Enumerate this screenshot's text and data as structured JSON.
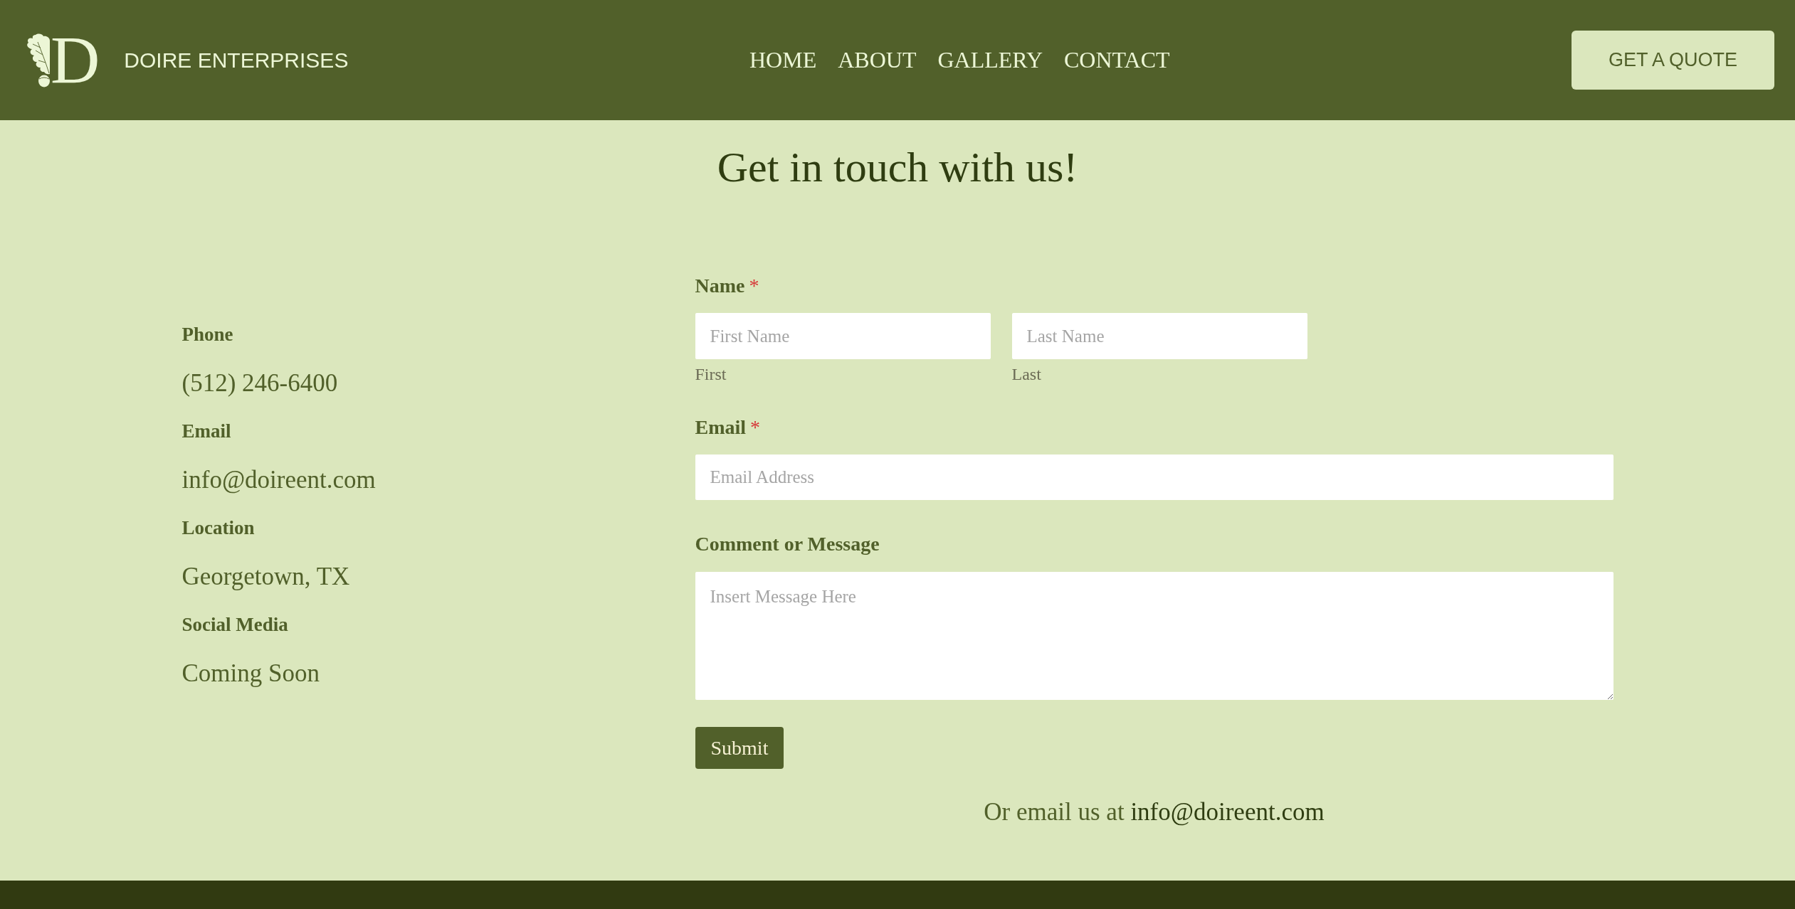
{
  "header": {
    "logo_letter": "D",
    "brand": "DOIRE ENTERPRISES",
    "nav": [
      {
        "label": "HOME"
      },
      {
        "label": "ABOUT"
      },
      {
        "label": "GALLERY"
      },
      {
        "label": "CONTACT"
      }
    ],
    "cta": "GET A QUOTE"
  },
  "title": "Get in touch with us!",
  "contact_info": [
    {
      "label": "Phone",
      "value": "(512) 246-6400"
    },
    {
      "label": "Email",
      "value": "info@doireent.com"
    },
    {
      "label": "Location",
      "value": "Georgetown, TX"
    },
    {
      "label": "Social Media",
      "value": "Coming Soon"
    }
  ],
  "form": {
    "required_mark": "*",
    "fields": [
      {
        "kind": "name",
        "label": "Name",
        "required": true,
        "inputs": [
          {
            "placeholder": "First Name",
            "sublabel": "First"
          },
          {
            "placeholder": "Last Name",
            "sublabel": "Last"
          }
        ]
      },
      {
        "kind": "email",
        "label": "Email",
        "required": true,
        "placeholder": "Email Address"
      },
      {
        "kind": "textarea",
        "label": "Comment or Message",
        "required": false,
        "placeholder": "Insert Message Here"
      }
    ],
    "submit": "Submit",
    "alt_contact": {
      "text": "Or email us at",
      "link": "info@doireent.com"
    }
  }
}
